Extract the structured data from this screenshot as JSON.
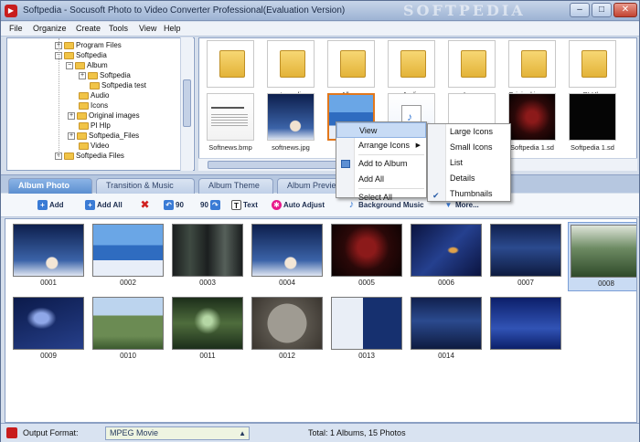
{
  "window": {
    "title": "Softpedia - Socusoft Photo to Video Converter Professional(Evaluation Version)",
    "watermark": "SOFTPEDIA",
    "min_label": "–",
    "max_label": "□",
    "close_label": "✕"
  },
  "menu": [
    "File",
    "Organize",
    "Create",
    "Tools",
    "View",
    "Help"
  ],
  "tree": {
    "items": [
      {
        "label": "Program Files",
        "expander": "+"
      },
      {
        "label": "Softpedia",
        "expander": "−"
      },
      {
        "label": "Album",
        "expander": "−"
      },
      {
        "label": "Softpedia",
        "expander": "+"
      },
      {
        "label": "Softpedia test",
        "expander": ""
      },
      {
        "label": "Audio",
        "expander": ""
      },
      {
        "label": "Icons",
        "expander": ""
      },
      {
        "label": "Original images",
        "expander": "+"
      },
      {
        "label": "PI Hlp",
        "expander": ""
      },
      {
        "label": "Softpedia_Files",
        "expander": "+"
      },
      {
        "label": "Video",
        "expander": ""
      },
      {
        "label": "Softpedia Files",
        "expander": "+"
      }
    ]
  },
  "thumbs": {
    "row1": [
      {
        "label": "..",
        "kind": "folder"
      },
      {
        "label": ".tempdir",
        "kind": "folder"
      },
      {
        "label": "Album",
        "kind": "folder"
      },
      {
        "label": "Audio",
        "kind": "folder"
      },
      {
        "label": "Icons",
        "kind": "folder"
      },
      {
        "label": "Original images",
        "kind": "folder"
      },
      {
        "label": "PI Hlp",
        "kind": "folder"
      }
    ],
    "row2": [
      {
        "label": "Softnews.bmp",
        "kind": "doc"
      },
      {
        "label": "softnews.jpg",
        "kind": "photo-blue"
      },
      {
        "label": "",
        "kind": "photo-snow"
      },
      {
        "label": "",
        "kind": "doc-audio"
      },
      {
        "label": "",
        "kind": "blank"
      },
      {
        "label": "Softpedia 1.sd",
        "kind": "photo-dark-red"
      },
      {
        "label": "Softpedia 1.sd",
        "kind": "photo-black"
      }
    ]
  },
  "context_menu": {
    "items": [
      "View",
      "Arrange Icons",
      "Add to Album",
      "Add All",
      "Select All"
    ]
  },
  "view_submenu": {
    "items": [
      "Large Icons",
      "Small Icons",
      "List",
      "Details",
      "Thumbnails"
    ],
    "checked": "Thumbnails"
  },
  "tabs": [
    "Album Photo",
    "Transition & Music",
    "Album Theme",
    "Album Preview"
  ],
  "toolbar": {
    "add": "Add",
    "add_all": "Add All",
    "rotate_left": "90",
    "rotate_right": "90",
    "text": "Text",
    "auto_adjust": "Auto Adjust",
    "background_music": "Background Music",
    "more": "More..."
  },
  "photos": [
    {
      "label": "0001",
      "tone": "blue-portrait"
    },
    {
      "label": "0002",
      "tone": "snow"
    },
    {
      "label": "0003",
      "tone": "dark-forest"
    },
    {
      "label": "0004",
      "tone": "blue-portrait"
    },
    {
      "label": "0005",
      "tone": "dark-red"
    },
    {
      "label": "0006",
      "tone": "blue-swirl"
    },
    {
      "label": "0007",
      "tone": "blue-ui"
    },
    {
      "label": "0008",
      "tone": "forest"
    },
    {
      "label": "0009",
      "tone": "blue-abstract"
    },
    {
      "label": "0010",
      "tone": "mountain"
    },
    {
      "label": "0011",
      "tone": "green-forest"
    },
    {
      "label": "0012",
      "tone": "softpedia-plate"
    },
    {
      "label": "0013",
      "tone": "screens"
    },
    {
      "label": "0014",
      "tone": "blue-ui"
    },
    {
      "label": "",
      "tone": "blue-book"
    }
  ],
  "status": {
    "output_label": "Output Format:",
    "format": "MPEG Movie",
    "summary": "Total: 1 Albums, 15 Photos"
  },
  "colors": {
    "accent": "#5b8fd0",
    "folder": "#f1c447"
  }
}
